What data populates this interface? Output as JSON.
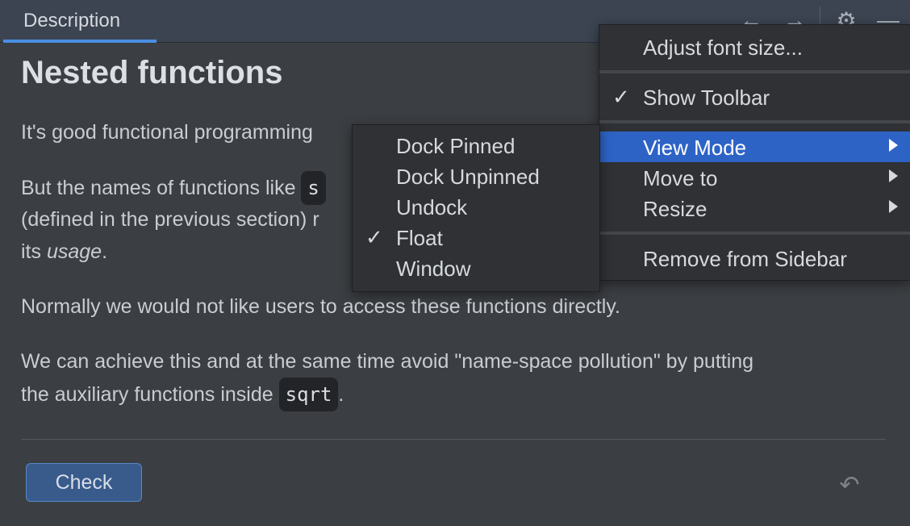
{
  "tab": {
    "label": "Description"
  },
  "header": {
    "back_icon": "←",
    "forward_icon": "→",
    "settings_icon": "⚙",
    "minimize_icon": "—"
  },
  "content": {
    "title": "Nested functions",
    "p1": "It's good functional programming",
    "p2_line1": "But the names of functions like",
    "p2_code": "s",
    "p2_line2": "(defined in the previous section) r",
    "p2_line3_prefix": "its ",
    "p2_line3_em": "usage",
    "p2_line3_suffix": ".",
    "p3": "Normally we would not like users to access these functions directly.",
    "p4_line1": "We can achieve this and at the same time avoid \"name-space pollution\" by putting",
    "p4_line2_prefix": "the auxiliary functions inside",
    "p4_code": "sqrt",
    "p4_line2_suffix": "."
  },
  "footer": {
    "check_label": "Check",
    "undo_icon": "↶"
  },
  "main_menu": {
    "items": [
      {
        "label": "Adjust font size...",
        "checked": false
      },
      {
        "label": "Show Toolbar",
        "checked": true
      },
      {
        "label": "View Mode",
        "submenu": true,
        "selected": true
      },
      {
        "label": "Move to",
        "submenu": true
      },
      {
        "label": "Resize",
        "submenu": true
      },
      {
        "label": "Remove from Sidebar"
      }
    ],
    "check_glyph": "✓"
  },
  "view_mode_menu": {
    "items": [
      {
        "label": "Dock Pinned"
      },
      {
        "label": "Dock Unpinned"
      },
      {
        "label": "Undock"
      },
      {
        "label": "Float",
        "checked": true
      },
      {
        "label": "Window"
      }
    ]
  },
  "colors": {
    "accent": "#4a8fe2",
    "selection": "#2e63c6",
    "button": "#385b8c"
  }
}
